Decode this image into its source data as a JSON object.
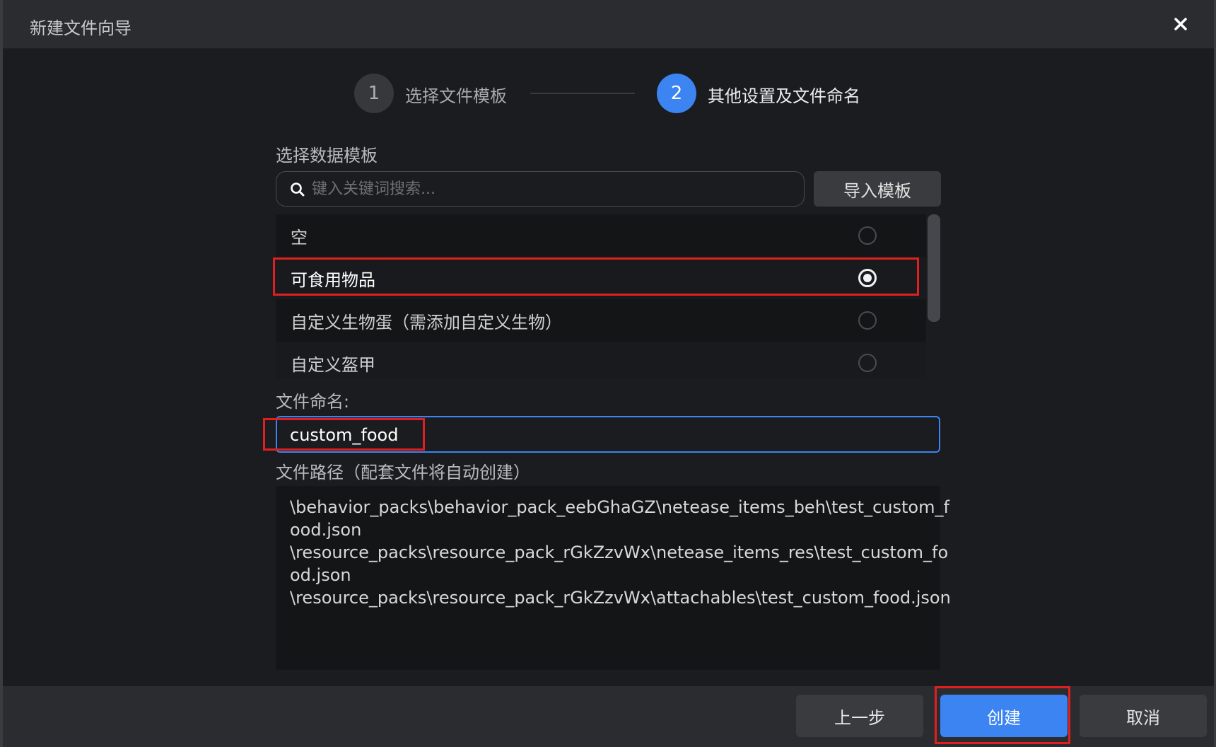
{
  "window": {
    "title": "新建文件向导"
  },
  "stepper": {
    "step1": {
      "number": "1",
      "label": "选择文件模板"
    },
    "step2": {
      "number": "2",
      "label": "其他设置及文件命名"
    }
  },
  "template_section": {
    "label": "选择数据模板",
    "search_placeholder": "键入关键词搜索...",
    "import_button": "导入模板",
    "items": [
      {
        "label": "空",
        "selected": false
      },
      {
        "label": "可食用物品",
        "selected": true
      },
      {
        "label": "自定义生物蛋（需添加自定义生物）",
        "selected": false
      },
      {
        "label": "自定义盔甲",
        "selected": false
      }
    ]
  },
  "filename_section": {
    "label": "文件命名:",
    "value": "custom_food"
  },
  "path_section": {
    "label": "文件路径（配套文件将自动创建）",
    "lines": [
      "\\behavior_packs\\behavior_pack_eebGhaGZ\\netease_items_beh\\test_custom_f",
      "ood.json",
      "\\resource_packs\\resource_pack_rGkZzvWx\\netease_items_res\\test_custom_fo",
      "od.json",
      "\\resource_packs\\resource_pack_rGkZzvWx\\attachables\\test_custom_food.json"
    ]
  },
  "footer": {
    "prev_button": "上一步",
    "create_button": "创建",
    "cancel_button": "取消"
  },
  "colors": {
    "accent": "#3b84f1",
    "highlight": "#e02020",
    "background": "#1b1c1f"
  }
}
